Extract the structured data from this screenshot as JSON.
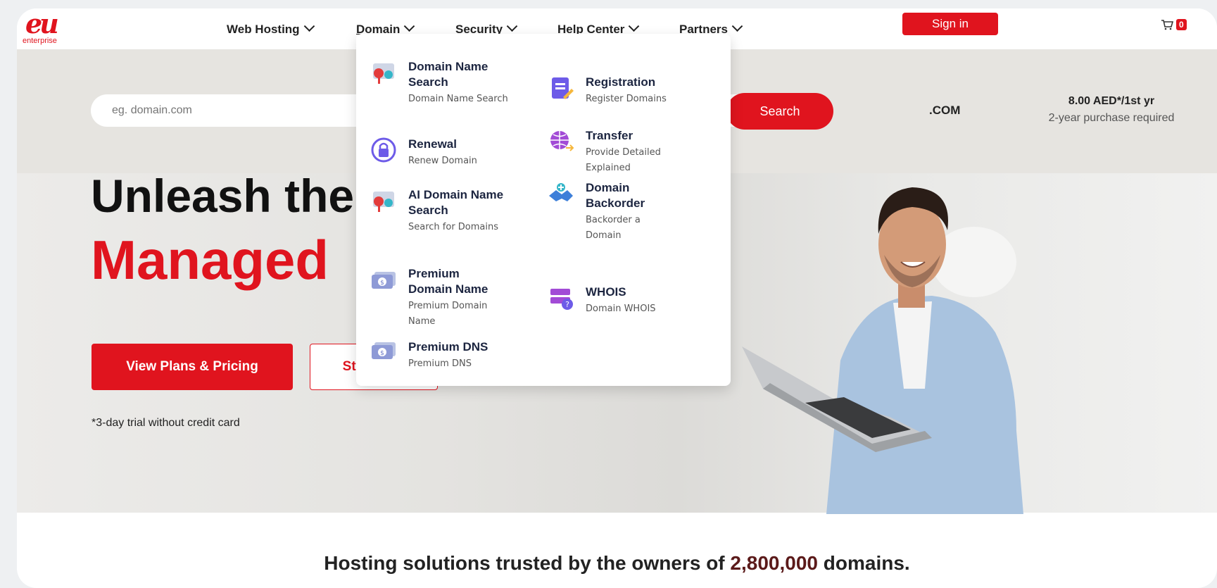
{
  "brand": {
    "logo_mark": "eu",
    "logo_text": "enterprise"
  },
  "nav": {
    "items": [
      {
        "label": "Web Hosting"
      },
      {
        "label": "Domain"
      },
      {
        "label": "Security"
      },
      {
        "label": "Help Center"
      },
      {
        "label": "Partners"
      }
    ],
    "active": "Domain",
    "signin": "Sign in",
    "cart_count": "0"
  },
  "search": {
    "placeholder": "eg. domain.com",
    "button": "Search",
    "tld": ".COM",
    "price": "8.00 AED*/1st yr",
    "price_note": "2-year purchase required"
  },
  "hero": {
    "title_line1": "Unleash the",
    "title_line2": "Managed",
    "btn_plans": "View Plans & Pricing",
    "btn_free": "Start Free",
    "trial_note": "*3-day trial without credit card"
  },
  "dropdown": {
    "items": [
      {
        "title": "Domain Name Search",
        "subtitle": "Domain Name Search",
        "icon": "domain-search-icon"
      },
      {
        "title": "Registration",
        "subtitle": "Register Domains",
        "icon": "registration-icon"
      },
      {
        "title": "Renewal",
        "subtitle": "Renew Domain",
        "icon": "renewal-lock-icon"
      },
      {
        "title": "Transfer",
        "subtitle": "Provide Detailed Explained",
        "icon": "transfer-globe-icon"
      },
      {
        "title": "AI Domain Name Search",
        "subtitle": "Search for Domains",
        "icon": "ai-domain-search-icon"
      },
      {
        "title": "Domain Backorder",
        "subtitle": "Backorder a Domain",
        "icon": "backorder-handshake-icon"
      },
      {
        "title": "Premium Domain Name",
        "subtitle": "Premium Domain Name",
        "icon": "premium-domain-icon"
      },
      {
        "title": "WHOIS",
        "subtitle": "Domain WHOIS",
        "icon": "whois-server-icon"
      },
      {
        "title": "Premium DNS",
        "subtitle": "Premium DNS",
        "icon": "premium-dns-icon"
      }
    ]
  },
  "trusted": {
    "prefix": "Hosting solutions trusted by the owners of ",
    "number": "2,800,000",
    "suffix": " domains."
  },
  "colors": {
    "brand_red": "#e0141e",
    "navy_text": "#1c2540"
  }
}
